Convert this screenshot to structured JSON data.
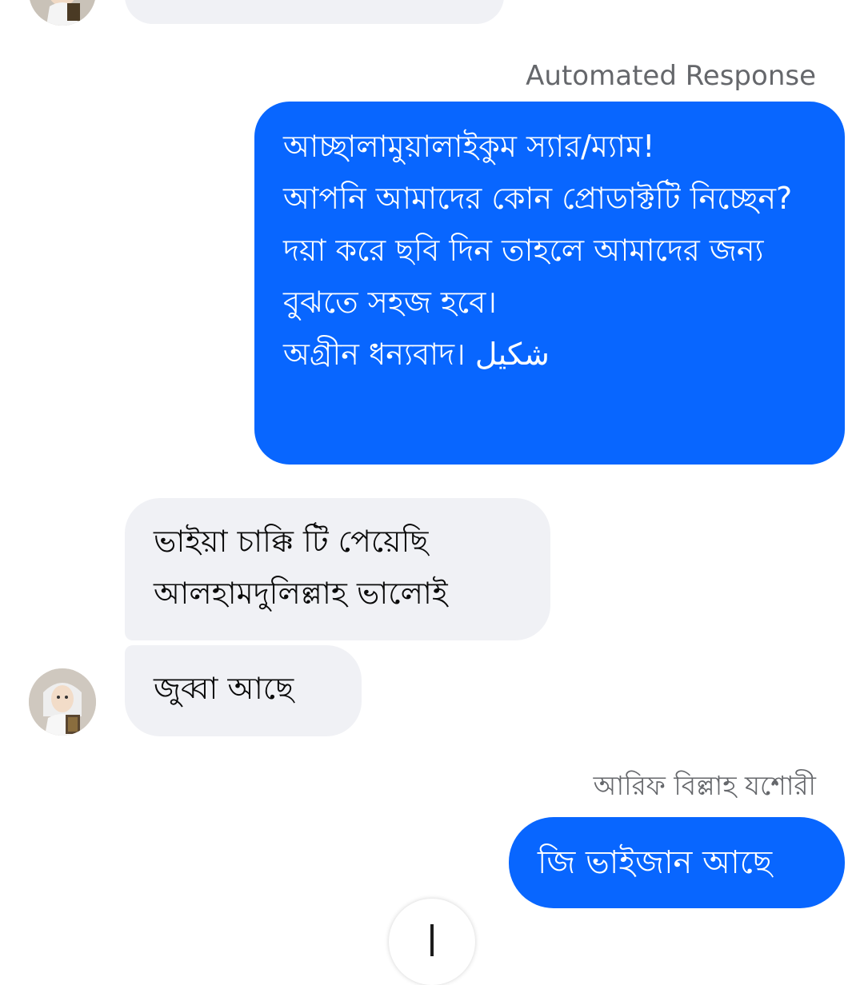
{
  "conversation": {
    "partial_top_message": {
      "text": ""
    },
    "automated": {
      "label": "Automated Response",
      "text": "আচ্ছালামুয়ালাইকুম স্যার/ম্যাম!\nআপনি আমাদের কোন প্রোডাক্টটি নিচ্ছেন?\nদয়া করে ছবি দিন তাহলে আমাদের জন্য বুঝতে সহজ হবে।\nঅগ্রীন ধন্যবাদ। شكيل"
    },
    "incoming_1": {
      "text": "ভাইয়া চাক্কি টি পেয়েছি\nআলহামদুলিল্লাহ ভালোই"
    },
    "incoming_2": {
      "text": "জুব্বা আছে"
    },
    "reply": {
      "sender": "আরিফ বিল্লাহ যশোরী",
      "text": "জি ভাইজান আছে"
    }
  },
  "colors": {
    "outgoing_bubble": "#0866ff",
    "incoming_bubble": "#f0f1f5",
    "secondary_text": "#65676b"
  },
  "icons": {
    "contact_avatar": "child-with-book-avatar",
    "scroll_control": "arrow-down-icon"
  }
}
